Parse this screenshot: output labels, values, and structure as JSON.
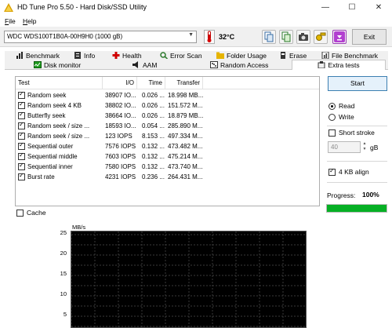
{
  "window": {
    "title": "HD Tune Pro 5.50 - Hard Disk/SSD Utility",
    "controls": {
      "minimize": "—",
      "maximize": "☐",
      "close": "✕"
    }
  },
  "menu": [
    {
      "underline": "F",
      "rest": "ile"
    },
    {
      "underline": "H",
      "rest": "elp"
    }
  ],
  "toolbar": {
    "drive": "WDC WDS100T1B0A-00H9H0 (1000 gB)",
    "temperature": "32",
    "temperature_unit": "°C",
    "buttons": [
      "copy-icon",
      "copy-info-icon",
      "screenshot-icon",
      "options-icon",
      "save-icon"
    ],
    "exit_label": "Exit"
  },
  "tabs": {
    "row1": [
      {
        "label": "Benchmark",
        "icon": "benchmark-icon"
      },
      {
        "label": "Info",
        "icon": "info-icon"
      },
      {
        "label": "Health",
        "icon": "health-icon"
      },
      {
        "label": "Error Scan",
        "icon": "error-scan-icon"
      },
      {
        "label": "Folder Usage",
        "icon": "folder-icon"
      },
      {
        "label": "Erase",
        "icon": "erase-icon"
      },
      {
        "label": "File Benchmark",
        "icon": "file-benchmark-icon"
      }
    ],
    "row2": [
      {
        "label": "Disk monitor",
        "icon": "disk-monitor-icon"
      },
      {
        "label": "AAM",
        "icon": "aam-icon"
      },
      {
        "label": "Random Access",
        "icon": "random-access-icon"
      },
      {
        "label": "Extra tests",
        "icon": "extra-tests-icon"
      }
    ]
  },
  "table": {
    "headers": [
      "Test",
      "I/O",
      "Time",
      "Transfer"
    ],
    "rows": [
      {
        "test": "Random seek",
        "io": "38907 IO...",
        "time": "0.026 ...",
        "transfer": "18.998 MB..."
      },
      {
        "test": "Random seek 4 KB",
        "io": "38802 IO...",
        "time": "0.026 ...",
        "transfer": "151.572 M..."
      },
      {
        "test": "Butterfly seek",
        "io": "38664 IO...",
        "time": "0.026 ...",
        "transfer": "18.879 MB..."
      },
      {
        "test": "Random seek / size ...",
        "io": "18593 IO...",
        "time": "0.054 ...",
        "transfer": "285.890 M..."
      },
      {
        "test": "Random seek / size ...",
        "io": "123 IOPS",
        "time": "8.153 ...",
        "transfer": "497.334 M..."
      },
      {
        "test": "Sequential outer",
        "io": "7576 IOPS",
        "time": "0.132 ...",
        "transfer": "473.482 M..."
      },
      {
        "test": "Sequential middle",
        "io": "7603 IOPS",
        "time": "0.132 ...",
        "transfer": "475.214 M..."
      },
      {
        "test": "Sequential inner",
        "io": "7580 IOPS",
        "time": "0.132 ...",
        "transfer": "473.740 M..."
      },
      {
        "test": "Burst rate",
        "io": "4231 IOPS",
        "time": "0.236 ...",
        "transfer": "264.431 M..."
      }
    ]
  },
  "controls": {
    "start_label": "Start",
    "read_label": "Read",
    "write_label": "Write",
    "mode": "read",
    "short_stroke_label": "Short stroke",
    "short_stroke_checked": false,
    "short_stroke_value": "40",
    "short_stroke_unit": "gB",
    "align_label": "4 KB align",
    "align_checked": true,
    "progress_label": "Progress:",
    "progress_text": "100%",
    "progress_value": 1.0,
    "progress_color": "#06b025"
  },
  "cache": {
    "label": "Cache",
    "checked": false
  },
  "graph": {
    "unit_label": "MB/s",
    "ticks": [
      "25",
      "20",
      "15",
      "10",
      "5"
    ],
    "grid_color": "#3a3a3a"
  }
}
